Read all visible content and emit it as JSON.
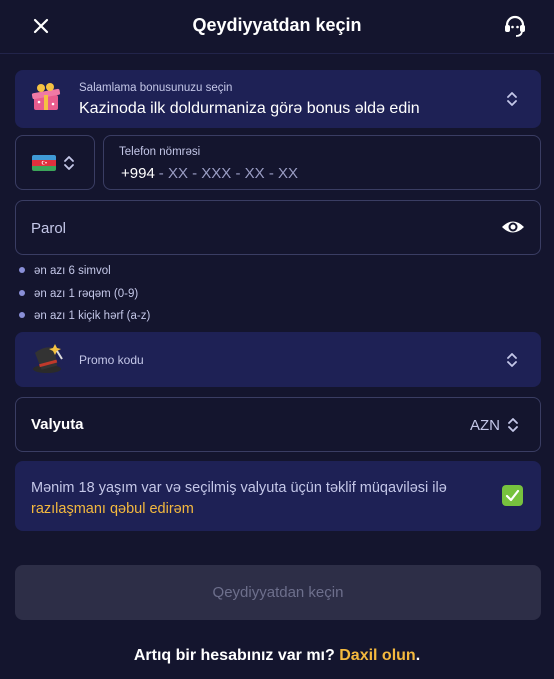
{
  "header": {
    "title": "Qeydiyyatdan keçin",
    "close_icon": "close-icon",
    "support_icon": "headset-support-icon"
  },
  "bonus": {
    "label": "Salamlama bonusunuzu seçin",
    "value": "Kazinoda ilk doldurmaniza görə bonus əldə edin",
    "icon": "gift-icon"
  },
  "phone": {
    "country_icon": "azerbaijan-flag-icon",
    "label": "Telefon nömrəsi",
    "code": "+994",
    "mask": "- XX - XXX - XX - XX"
  },
  "password": {
    "placeholder": "Parol",
    "icon": "eye-icon",
    "rules": [
      "ən azı 6 simvol",
      "ən azı 1 rəqəm (0-9)",
      "ən azı 1 kiçik hərf (a-z)"
    ]
  },
  "promo": {
    "label": "Promo kodu",
    "icon": "magic-hat-icon"
  },
  "currency": {
    "label": "Valyuta",
    "value": "AZN"
  },
  "agreement": {
    "text": "Mənim 18 yaşım var və seçilmiş valyuta üçün təklif müqaviləsi ilə",
    "link": "razılaşmanı qəbul edirəm",
    "checked": true
  },
  "submit": {
    "label": "Qeydiyyatdan keçin"
  },
  "footer": {
    "question": "Artıq bir hesabınız var mı?",
    "login": "Daxil olun",
    "end": "."
  },
  "colors": {
    "background": "#14152e",
    "panel": "#1e2155",
    "accent": "#f4b93e",
    "check": "#77c23e"
  }
}
